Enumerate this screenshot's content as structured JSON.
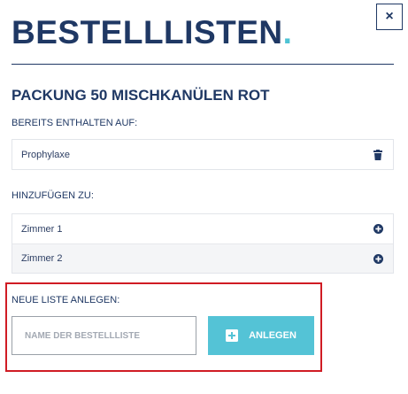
{
  "header": {
    "title": "BESTELLLISTEN",
    "title_dot": ".",
    "close_label": "×"
  },
  "product": {
    "name": "PACKUNG 50 MISCHKANÜLEN ROT"
  },
  "already_contained": {
    "label": "BEREITS ENTHALTEN AUF:",
    "items": [
      {
        "label": "Prophylaxe",
        "icon": "trash-icon"
      }
    ]
  },
  "add_to": {
    "label": "HINZUFÜGEN ZU:",
    "items": [
      {
        "label": "Zimmer 1",
        "icon": "plus-circle-icon"
      },
      {
        "label": "Zimmer 2",
        "icon": "plus-circle-icon"
      }
    ]
  },
  "new_list": {
    "label": "NEUE LISTE ANLEGEN:",
    "input_placeholder": "NAME DER BESTELLLISTE",
    "button_label": "ANLEGEN",
    "button_icon": "plus-square-icon"
  },
  "colors": {
    "navy": "#1f3864",
    "accent": "#4ec3d4",
    "button": "#54c3d6",
    "highlight": "#d01c24"
  }
}
